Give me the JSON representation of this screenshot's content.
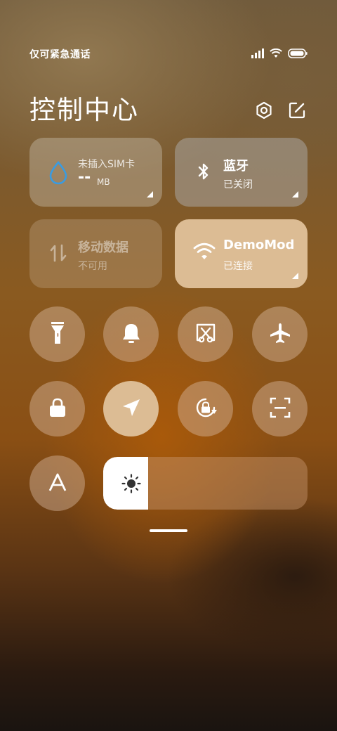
{
  "status_bar": {
    "carrier_text": "仅可紧急通话",
    "icons": [
      "signal-icon",
      "wifi-icon",
      "battery-icon"
    ]
  },
  "header": {
    "title": "控制中心",
    "settings_icon": "gear-icon",
    "edit_icon": "edit-icon"
  },
  "tiles": {
    "data_usage": {
      "main": "未插入SIM卡",
      "value": "--",
      "unit": "MB",
      "icon": "water-drop-icon"
    },
    "bluetooth": {
      "main": "蓝牙",
      "sub": "已关闭",
      "icon": "bluetooth-icon"
    },
    "mobile_data": {
      "main": "移动数据",
      "sub": "不可用",
      "icon": "data-arrows-icon"
    },
    "wifi": {
      "main": "DemoMod",
      "sub": "已连接",
      "icon": "wifi-icon"
    }
  },
  "toggles": [
    {
      "name": "flashlight",
      "icon": "flashlight-icon",
      "active": false
    },
    {
      "name": "silent",
      "icon": "bell-icon",
      "active": false
    },
    {
      "name": "screenshot",
      "icon": "scissors-screenshot-icon",
      "active": false
    },
    {
      "name": "airplane",
      "icon": "airplane-icon",
      "active": false
    },
    {
      "name": "lock",
      "icon": "lock-icon",
      "active": false
    },
    {
      "name": "location",
      "icon": "location-arrow-icon",
      "active": true
    },
    {
      "name": "rotation-lock",
      "icon": "rotation-lock-icon",
      "active": false
    },
    {
      "name": "scanner",
      "icon": "scan-icon",
      "active": false
    },
    {
      "name": "auto-brightness",
      "icon": "font-a-icon",
      "active": false
    }
  ],
  "brightness": {
    "level": 0.22,
    "icon": "sun-icon"
  },
  "colors": {
    "accent": "#dcbc94",
    "tile_bg": "rgba(200,190,175,0.42)",
    "drop_blue": "#3a9be0"
  }
}
